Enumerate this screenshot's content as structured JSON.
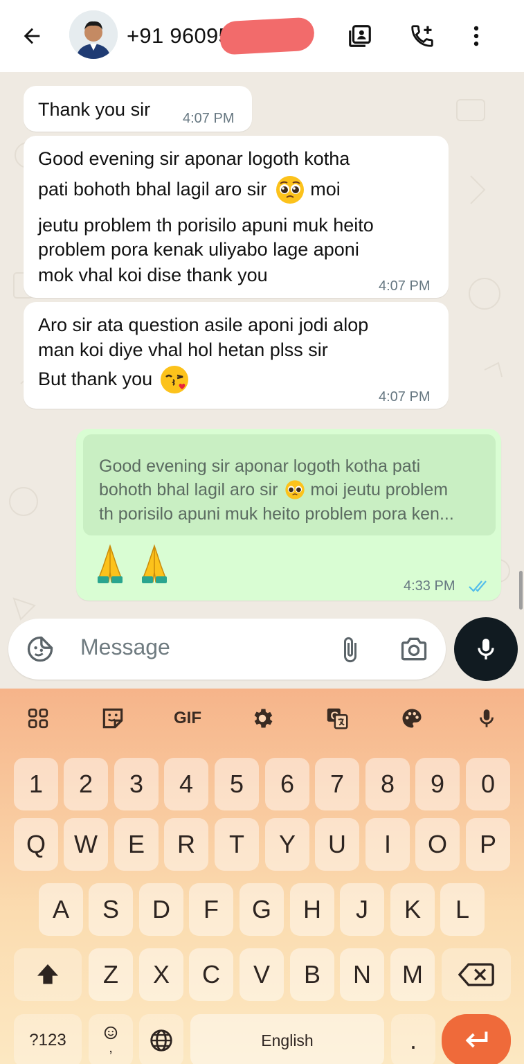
{
  "header": {
    "contact_name": "+91 96095",
    "icons": [
      "back-arrow-icon",
      "contact-card-icon",
      "add-call-icon",
      "more-vert-icon"
    ]
  },
  "messages": [
    {
      "direction": "in",
      "lines": [
        "Thank you sir"
      ],
      "time": "4:07 PM"
    },
    {
      "direction": "in",
      "lines": [
        "Good evening sir aponar logoth kotha",
        "pati bohoth bhal lagil aro sir",
        "moi",
        "jeutu problem th porisilo apuni muk heito",
        "problem pora kenak uliyabo lage aponi",
        "mok vhal koi dise thank you"
      ],
      "emoji": "pleading-face",
      "time": "4:07 PM"
    },
    {
      "direction": "in",
      "lines": [
        "Aro sir ata question asile aponi jodi alop",
        "man koi diye vhal hol hetan plss sir",
        "But thank you"
      ],
      "emoji": "face-blowing-kiss",
      "time": "4:07 PM"
    },
    {
      "direction": "out",
      "quote": [
        "Good evening sir aponar logoth kotha pati",
        "bohoth bhal lagil aro sir",
        "moi jeutu problem",
        "th porisilo apuni muk heito problem pora ken..."
      ],
      "body_emoji": "folded-hands folded-hands",
      "time": "4:33 PM",
      "status": "read"
    }
  ],
  "input": {
    "placeholder": "Message"
  },
  "keyboard": {
    "toolbar": [
      "apps-grid-icon",
      "sticker-icon",
      "GIF",
      "settings-gear-icon",
      "translate-icon",
      "palette-icon",
      "mic-icon"
    ],
    "row_numbers": [
      "1",
      "2",
      "3",
      "4",
      "5",
      "6",
      "7",
      "8",
      "9",
      "0"
    ],
    "row_q": [
      "Q",
      "W",
      "E",
      "R",
      "T",
      "Y",
      "U",
      "I",
      "O",
      "P"
    ],
    "row_a": [
      "A",
      "S",
      "D",
      "F",
      "G",
      "H",
      "J",
      "K",
      "L"
    ],
    "row_z": [
      "Z",
      "X",
      "C",
      "V",
      "B",
      "N",
      "M"
    ],
    "symbols_key": "?123",
    "comma_key": ",",
    "space_label": "English",
    "period_key": "."
  },
  "colors": {
    "outgoing_bubble": "#d9fdd3",
    "incoming_bubble": "#ffffff",
    "chat_bg": "#efeae2",
    "keyboard_accent": "#ef6a3a",
    "read_ticks": "#53bdeb"
  }
}
